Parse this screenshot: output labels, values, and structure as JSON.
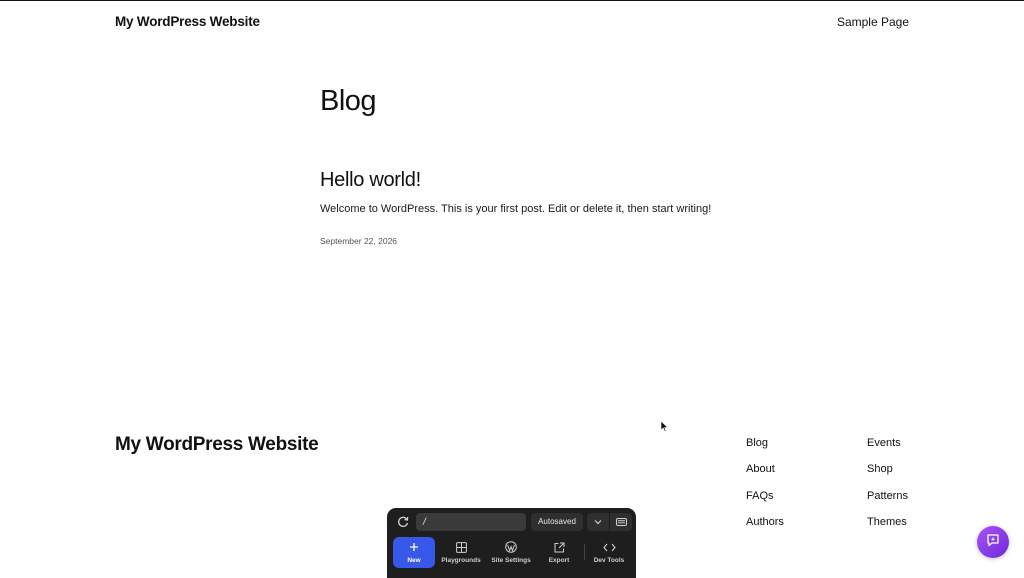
{
  "header": {
    "site_title": "My WordPress Website",
    "nav": [
      "Sample Page"
    ]
  },
  "main": {
    "page_title": "Blog",
    "posts": [
      {
        "title": "Hello world!",
        "excerpt": "Welcome to WordPress. This is your first post. Edit or delete it, then start writing!",
        "date": "September 22, 2026"
      }
    ]
  },
  "footer": {
    "site_title": "My WordPress Website",
    "links_col1": [
      "Blog",
      "About",
      "FAQs",
      "Authors"
    ],
    "links_col2": [
      "Events",
      "Shop",
      "Patterns",
      "Themes"
    ]
  },
  "playground_toolbar": {
    "url_value": "/",
    "autosaved_label": "Autosaved",
    "buttons": {
      "new": "New",
      "playgrounds": "Playgrounds",
      "site_settings": "Site Settings",
      "export": "Export",
      "dev_tools": "Dev Tools"
    },
    "icons": [
      "refresh-icon",
      "chevron-down-icon",
      "keyboard-icon",
      "plus-icon",
      "grid-icon",
      "wordpress-icon",
      "export-icon",
      "code-icon"
    ],
    "accent_color": "#3858e9",
    "background_color": "#1e1e1e"
  },
  "assistant_button": {
    "icon": "ai-chat-icon",
    "gradient": [
      "#a855f7",
      "#6d28d9"
    ]
  }
}
